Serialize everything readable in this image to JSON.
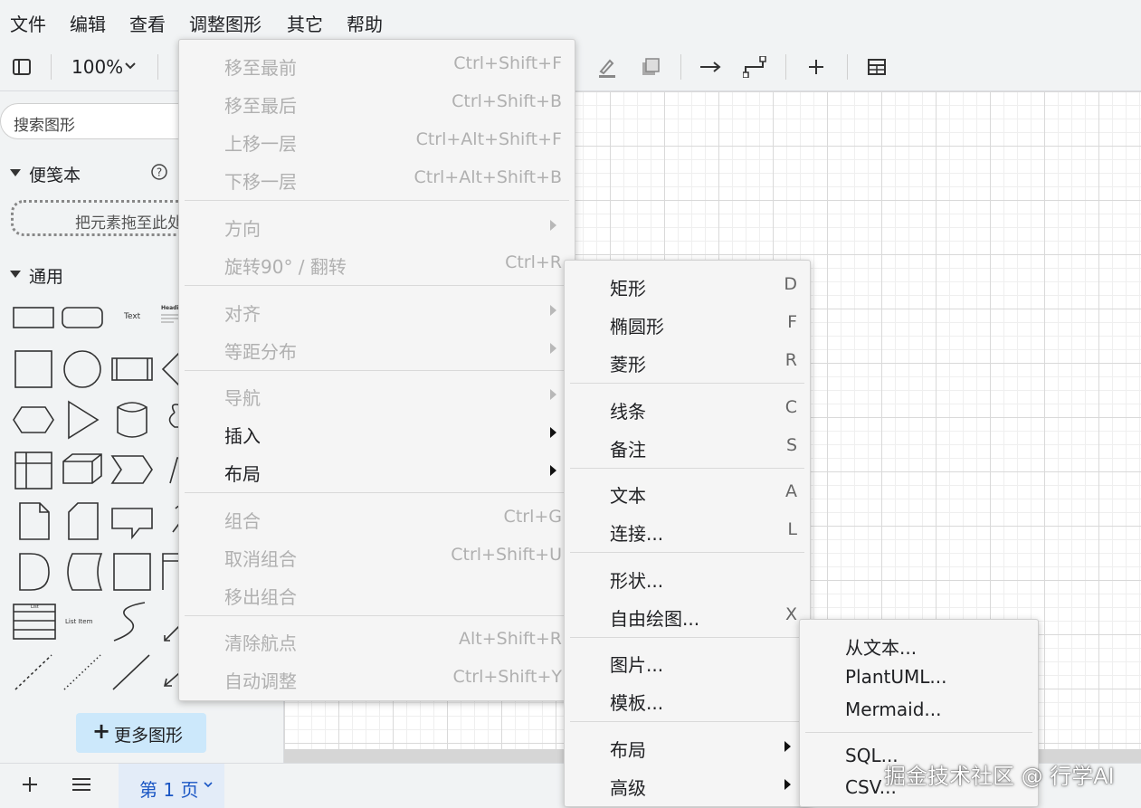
{
  "menubar": {
    "items": [
      "文件",
      "编辑",
      "查看",
      "调整图形",
      "其它",
      "帮助"
    ]
  },
  "toolbar": {
    "zoom": "100%"
  },
  "sidebar": {
    "search_placeholder": "搜索图形",
    "scratchpad_title": "便笺本",
    "scratchpad_drop_text": "把元素拖至此处",
    "general_title": "通用",
    "shape_labels": {
      "text": "Text",
      "heading": "Headin",
      "list": "List",
      "list_item": "List Item"
    },
    "more_shapes": "更多图形"
  },
  "bottombar": {
    "page_tab": "第 1 页"
  },
  "arrange_menu": {
    "items": [
      {
        "label": "移至最前",
        "shortcut": "Ctrl+Shift+F",
        "enabled": false
      },
      {
        "label": "移至最后",
        "shortcut": "Ctrl+Shift+B",
        "enabled": false
      },
      {
        "label": "上移一层",
        "shortcut": "Ctrl+Alt+Shift+F",
        "enabled": false
      },
      {
        "label": "下移一层",
        "shortcut": "Ctrl+Alt+Shift+B",
        "enabled": false
      },
      {
        "label": "方向",
        "shortcut": "",
        "enabled": false,
        "submenu": true
      },
      {
        "label": "旋转90° / 翻转",
        "shortcut": "Ctrl+R",
        "enabled": false
      },
      {
        "label": "对齐",
        "shortcut": "",
        "enabled": false,
        "submenu": true
      },
      {
        "label": "等距分布",
        "shortcut": "",
        "enabled": false,
        "submenu": true
      },
      {
        "label": "导航",
        "shortcut": "",
        "enabled": false,
        "submenu": true
      },
      {
        "label": "插入",
        "shortcut": "",
        "enabled": true,
        "submenu": true
      },
      {
        "label": "布局",
        "shortcut": "",
        "enabled": true,
        "submenu": true
      },
      {
        "label": "组合",
        "shortcut": "Ctrl+G",
        "enabled": false
      },
      {
        "label": "取消组合",
        "shortcut": "Ctrl+Shift+U",
        "enabled": false
      },
      {
        "label": "移出组合",
        "shortcut": "",
        "enabled": false
      },
      {
        "label": "清除航点",
        "shortcut": "Alt+Shift+R",
        "enabled": false
      },
      {
        "label": "自动调整",
        "shortcut": "Ctrl+Shift+Y",
        "enabled": false
      }
    ]
  },
  "insert_menu": {
    "items": [
      {
        "label": "矩形",
        "shortcut": "D"
      },
      {
        "label": "椭圆形",
        "shortcut": "F"
      },
      {
        "label": "菱形",
        "shortcut": "R"
      },
      {
        "label": "线条",
        "shortcut": "C"
      },
      {
        "label": "备注",
        "shortcut": "S"
      },
      {
        "label": "文本",
        "shortcut": "A"
      },
      {
        "label": "连接...",
        "shortcut": "L"
      },
      {
        "label": "形状...",
        "shortcut": ""
      },
      {
        "label": "自由绘图...",
        "shortcut": "X"
      },
      {
        "label": "图片...",
        "shortcut": ""
      },
      {
        "label": "模板...",
        "shortcut": ""
      },
      {
        "label": "布局",
        "shortcut": "",
        "submenu": true
      },
      {
        "label": "高级",
        "shortcut": "",
        "submenu": true
      }
    ]
  },
  "advanced_menu": {
    "items": [
      "从文本...",
      "PlantUML...",
      "Mermaid...",
      "SQL...",
      "CSV..."
    ]
  },
  "watermark": "掘金技术社区 @ 行学AI"
}
